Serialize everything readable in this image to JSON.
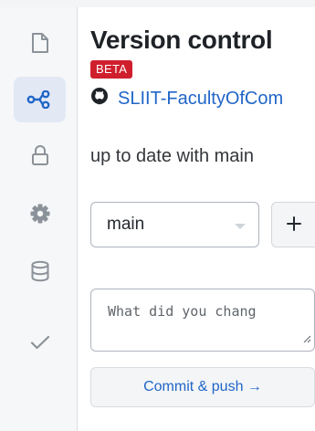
{
  "sidebar": {
    "items": [
      {
        "icon": "file-icon",
        "name": "sidebar-item-files",
        "active": false
      },
      {
        "icon": "share-nodes-icon",
        "name": "sidebar-item-version-control",
        "active": true
      },
      {
        "icon": "lock-icon",
        "name": "sidebar-item-secrets",
        "active": false
      },
      {
        "icon": "gear-icon",
        "name": "sidebar-item-settings",
        "active": false
      },
      {
        "icon": "database-icon",
        "name": "sidebar-item-database",
        "active": false
      },
      {
        "icon": "check-icon",
        "name": "sidebar-item-checks",
        "active": false
      }
    ]
  },
  "panel": {
    "title": "Version control",
    "badge": "BETA",
    "repo": {
      "icon": "github-icon",
      "name": "SLIIT-FacultyOfCom"
    },
    "sync_status": "up to date with main",
    "branch": {
      "value": "main",
      "add_label": "+"
    },
    "commit": {
      "placeholder": "What did you chang",
      "button_label": "Commit & push →"
    }
  },
  "colors": {
    "accent": "#2166c7",
    "badge": "#cf1f2d",
    "active_item": "#e2e9f5",
    "icon": "#8b9299"
  }
}
